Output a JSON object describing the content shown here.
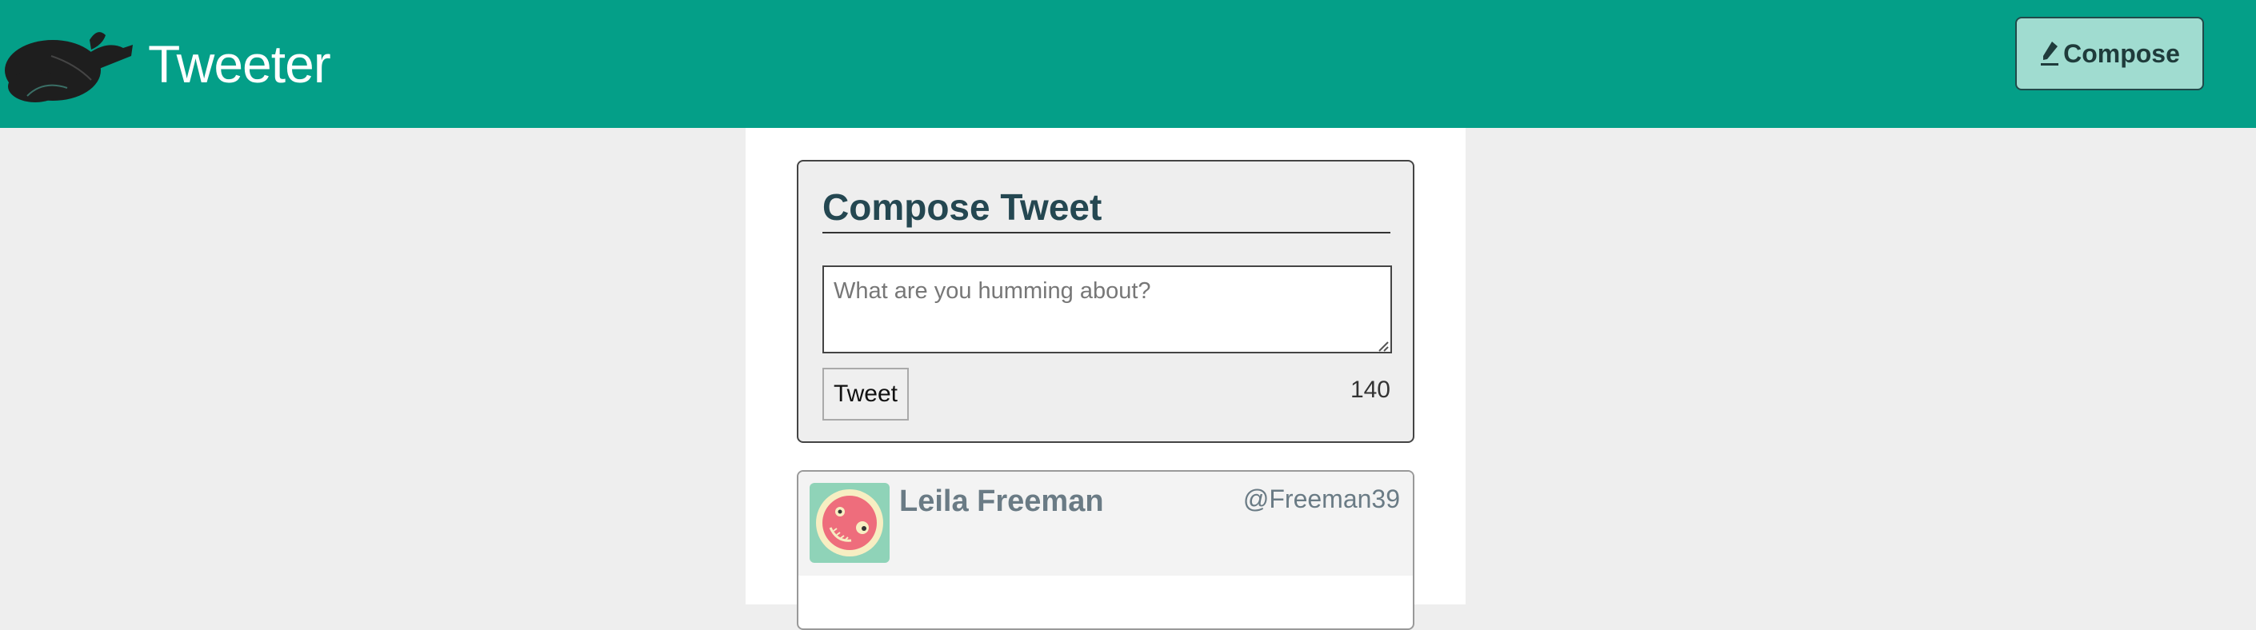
{
  "navbar": {
    "brand": "Tweeter",
    "logo_icon": "roast-bird-logo",
    "compose_label": "Compose",
    "compose_icon": "pen-icon",
    "background_color": "#049f88",
    "button_color": "#a0dcd0"
  },
  "compose": {
    "title": "Compose Tweet",
    "placeholder": "What are you humming about?",
    "submit_label": "Tweet",
    "counter": "140"
  },
  "tweets": [
    {
      "name": "Leila Freeman",
      "handle": "@Freeman39",
      "avatar_icon": "smiley-face-avatar"
    }
  ]
}
